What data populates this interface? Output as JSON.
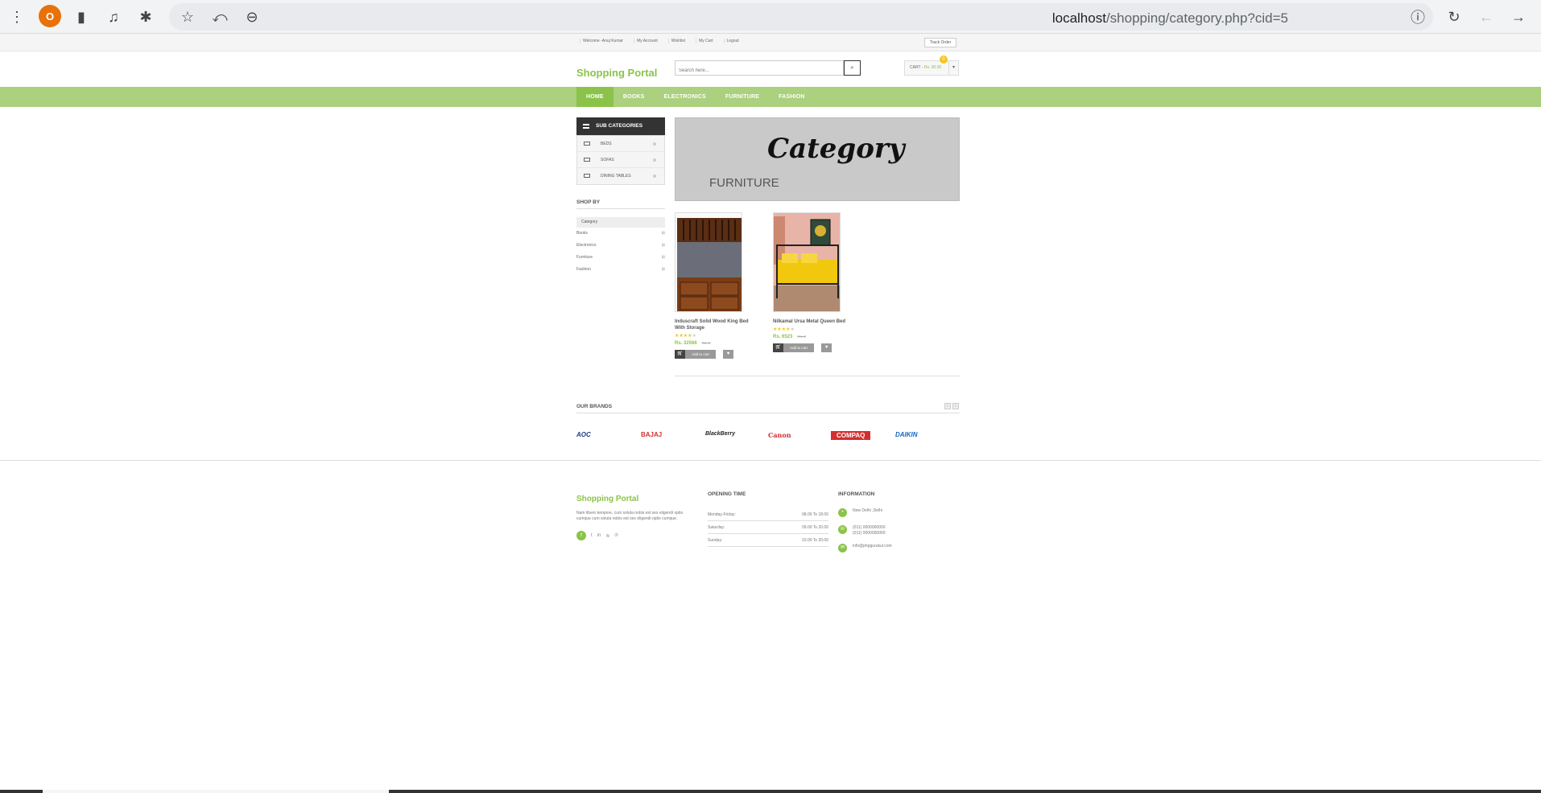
{
  "browser": {
    "avatar_letter": "O",
    "url_host": "localhost",
    "url_path": "/shopping/category.php?cid=5"
  },
  "topbar": {
    "links": [
      "Welcome -Anuj Kumar",
      "My Account",
      "Wishlist",
      "My Cart",
      "Logout"
    ],
    "track_label": "Track Order"
  },
  "header": {
    "logo": "Shopping Portal",
    "search_placeholder": "Search here...",
    "cart_label": "CART -",
    "cart_value": "Rs. 00.00",
    "cart_count": "0"
  },
  "nav": {
    "items": [
      "HOME",
      "BOOKS",
      "ELECTRONICS",
      "FURNITURE",
      "FASHION"
    ]
  },
  "sidebar": {
    "subcat_title": "SUB CATEGORIES",
    "subcats": [
      "BEDS",
      "SOFAS",
      "DINING TABLES"
    ],
    "shopby_title": "SHOP BY",
    "category_label": "Category",
    "categories": [
      "Books",
      "Electronics",
      "Furniture",
      "Fashion"
    ]
  },
  "banner": {
    "title": "Category",
    "subtitle": "FURNITURE"
  },
  "products": [
    {
      "name": "Induscraft Solid Wood King Bed With Storage",
      "price": "Rs. 32566",
      "old_price": "Rs. 0",
      "rating": 4,
      "add_to_cart": "Add to cart"
    },
    {
      "name": "Nilkamal Ursa Metal Queen Bed",
      "price": "Rs. 6523",
      "old_price": "Rs. 0",
      "rating": 4,
      "add_to_cart": "Add to cart"
    }
  ],
  "brands": {
    "title": "OUR BRANDS",
    "items": [
      "AOC",
      "BAJAJ",
      "BlackBerry",
      "Canon",
      "COMPAQ",
      "DAIKIN"
    ],
    "colors": [
      "#1e3a8a",
      "#d32f2f",
      "#222222",
      "#d32f2f",
      "#d32f2f",
      "#1565c0"
    ]
  },
  "footer": {
    "logo": "Shopping Portal",
    "text": "Nam libero tempore, cum soluta nobis est ses eligendi optio cumque cum soluta nobis est ses eligendi optio cumque.",
    "opening_title": "OPENING TIME",
    "hours": [
      {
        "day": "Monday-Friday:",
        "time": "08.00 To 18.00"
      },
      {
        "day": "Saturday:",
        "time": "09.00 To 20.00"
      },
      {
        "day": "Sunday:",
        "time": "10.00 To 20.00"
      }
    ],
    "info_title": "INFORMATION",
    "address": "New Delhi ,Delhi",
    "phones": [
      "(011) 0000000000",
      "(011) 0000000000"
    ],
    "email": "info@phpgurukul.com"
  },
  "colors": {
    "accent": "#8bc34a",
    "nav_bg": "#abd07e"
  }
}
